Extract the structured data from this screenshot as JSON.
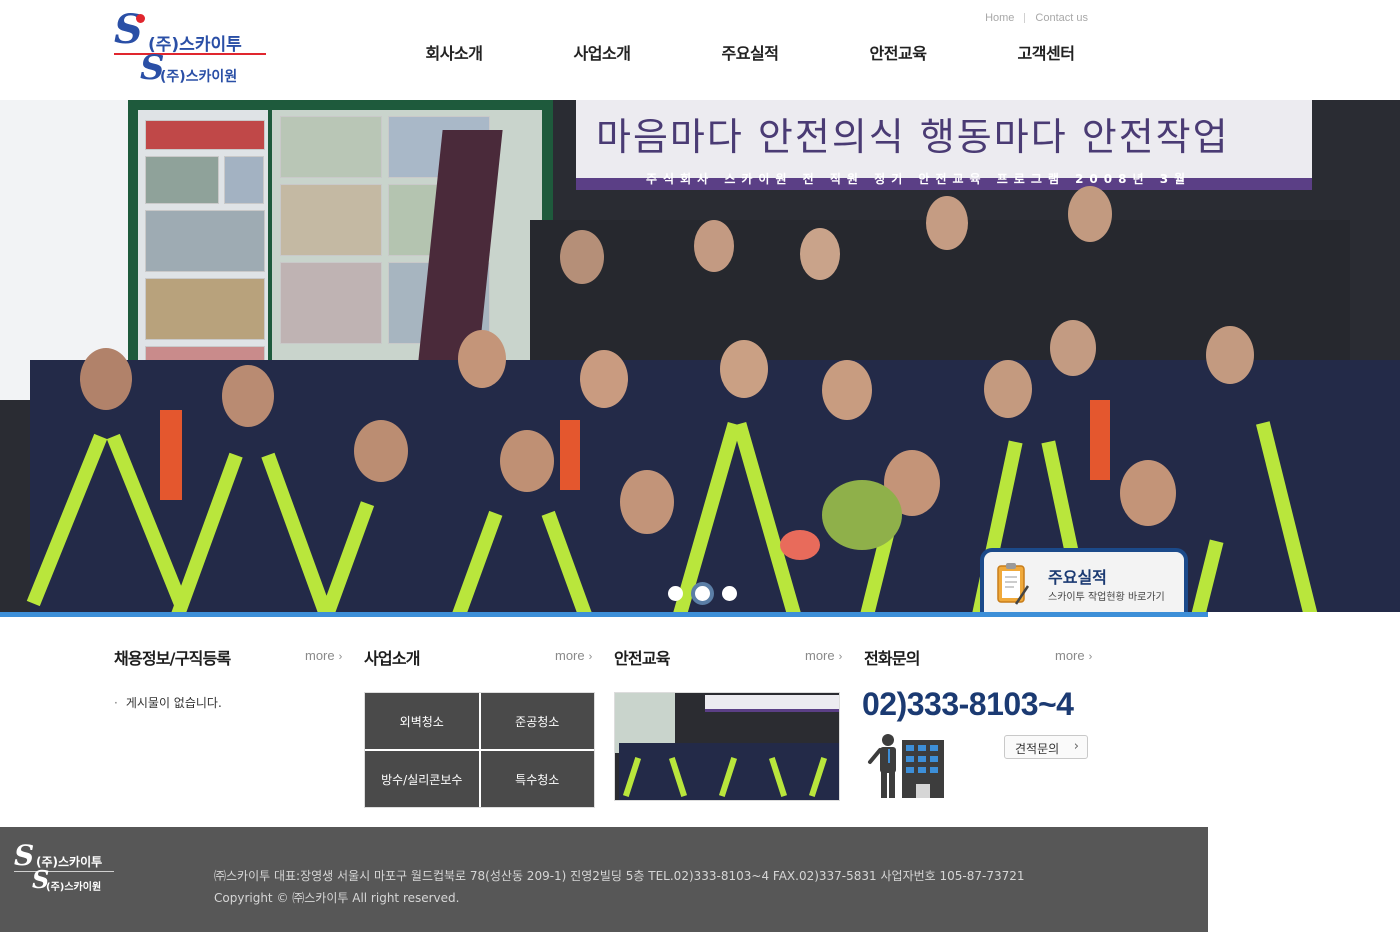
{
  "header": {
    "logo_primary": "(주)스카이투",
    "logo_secondary": "(주)스카이원",
    "utility_links": [
      "Home",
      "Contact us"
    ],
    "nav": [
      "회사소개",
      "사업소개",
      "주요실적",
      "안전교육",
      "고객센터"
    ]
  },
  "hero": {
    "banner_main": "마음마다 안전의식 행동마다 안전작업",
    "banner_sub": "주식회사 스카이원 전 직원 정기 안전교육 프로그램 2008년 3월",
    "slider": {
      "count": 3,
      "active_index": 1
    },
    "quick_card": {
      "title": "주요실적",
      "subtitle": "스카이투 작업현황 바로가기",
      "icon": "clipboard-pencil-icon"
    }
  },
  "sections": {
    "recruit": {
      "title": "채용정보/구직등록",
      "more": "more",
      "items": [
        "게시물이 없습니다."
      ]
    },
    "business": {
      "title": "사업소개",
      "more": "more",
      "grid": [
        "외벽청소",
        "준공청소",
        "방수/실리콘보수",
        "특수청소"
      ]
    },
    "education": {
      "title": "안전교육",
      "more": "more"
    },
    "contact": {
      "title": "전화문의",
      "more": "more",
      "phone": "02)333-8103~4",
      "quote_button": "견적문의"
    }
  },
  "footer": {
    "logo_primary": "(주)스카이투",
    "logo_secondary": "(주)스카이원",
    "address": "㈜스카이투 대표:장영생 서울시 마포구 월드컵북로 78(성산동 209-1) 진영2빌딩 5층 TEL.02)333-8103~4 FAX.02)337-5831 사업자번호 105-87-73721",
    "copyright": "Copyright © ㈜스카이투 All right reserved."
  },
  "colors": {
    "brand_blue": "#2a4fa6",
    "brand_red": "#e0262e",
    "accent_bar": "#3d8fd8",
    "navy": "#1b3a72",
    "footer_bg": "#575757"
  }
}
